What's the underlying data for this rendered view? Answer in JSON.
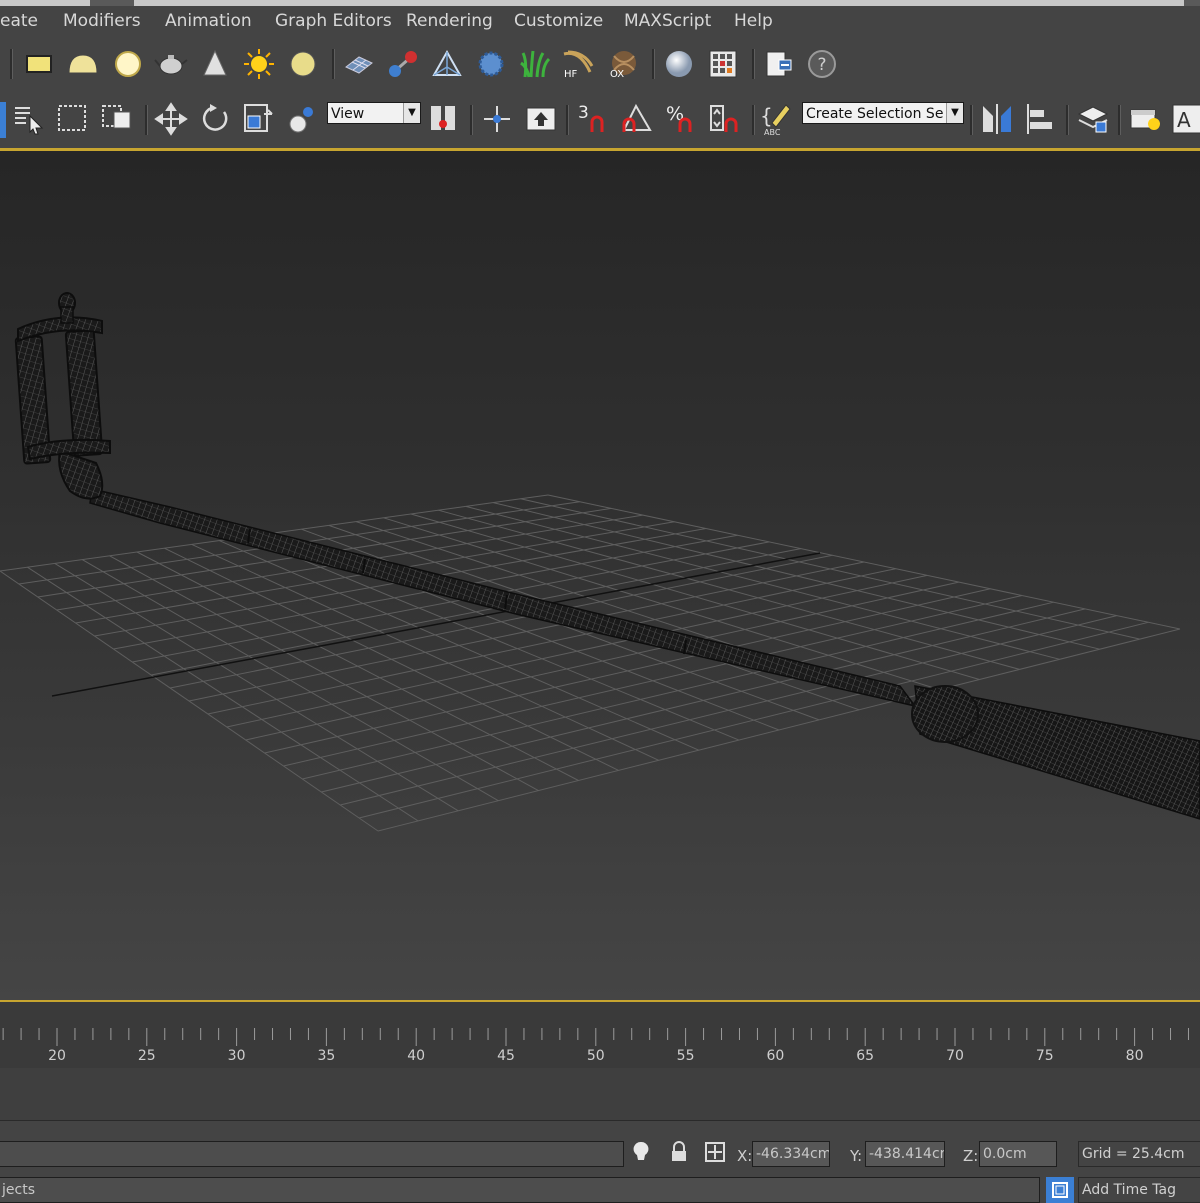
{
  "menu": {
    "items": [
      "eate",
      "Modifiers",
      "Animation",
      "Graph Editors",
      "Rendering",
      "Customize",
      "MAXScript",
      "Help"
    ]
  },
  "toolbar_top": {
    "icons": [
      "plane-icon",
      "dome-icon",
      "sphere-light-icon",
      "teapot-icon",
      "cone-icon",
      "sun-icon",
      "sphere-icon",
      "mesh-icon",
      "bone-icon",
      "pyramid-icon",
      "gear-sphere-icon",
      "grass-icon",
      "hair-icon",
      "ornatrix-icon",
      "material-ball-icon",
      "material-editor-icon",
      "render-setup-icon",
      "help-icon"
    ],
    "hair_label": "HF",
    "ox_label": "OX"
  },
  "toolbar_main": {
    "reference_coord": "View",
    "named_selection": "Create Selection Se",
    "snap_label": "3",
    "percent_label": "%",
    "abc_label": "ABC"
  },
  "timeline": {
    "ticks": [
      "20",
      "25",
      "30",
      "35",
      "40",
      "45",
      "50",
      "55",
      "60",
      "65",
      "70",
      "75",
      "80"
    ]
  },
  "status": {
    "prompt": "jects",
    "x_label": "X:",
    "x_value": "-46.334cm",
    "y_label": "Y:",
    "y_value": "-438.414cr",
    "z_label": "Z:",
    "z_value": "0.0cm",
    "grid": "Grid = 25.4cm",
    "add_time_tag": "Add Time Tag"
  },
  "colors": {
    "viewport_border": "#c7a530",
    "ui_background": "#444444"
  }
}
